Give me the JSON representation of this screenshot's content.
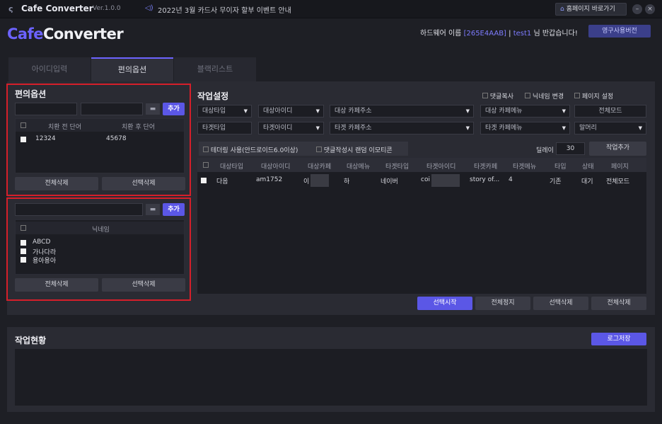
{
  "titlebar": {
    "title": "Cafe Converter",
    "version": "Ver.1.0.0",
    "notice": "2022년 3월 카드사 무이자 할부 이벤트 안내",
    "home_button": "홈페이지 바로가기",
    "minimize": "–",
    "close": "×"
  },
  "header": {
    "brand_part1": "Cafe",
    "brand_part2": "Converter",
    "hw_label": "하드웨어 이름 ",
    "hw_id": "[265E4AAB]",
    "separator": " | ",
    "user": "test1",
    "greeting": " 님 반갑습니다!",
    "license_button": "영구사용버전"
  },
  "tabs": [
    {
      "label": "아이디입력",
      "active": false
    },
    {
      "label": "편의옵션",
      "active": true
    },
    {
      "label": "블랙리스트",
      "active": false
    }
  ],
  "convenience": {
    "title": "편의옵션",
    "add_label": "추가",
    "folder_icon": "folder-icon",
    "replace_grid": {
      "col_before": "치환 전 단어",
      "col_after": "치환 후 단어",
      "rows": [
        {
          "before": "12324",
          "after": "45678"
        }
      ]
    },
    "delete_all": "전체삭제",
    "delete_selected": "선택삭제",
    "nick_grid": {
      "col": "닉네임",
      "rows": [
        "ABCD",
        "가나다라",
        "용아용아"
      ]
    }
  },
  "work_settings": {
    "title": "작업설정",
    "options": {
      "copy_comment": "댓글복사",
      "change_nick": "닉네임 변경",
      "page_setting": "페이지 설정"
    },
    "row1": {
      "target_type": "대상타입",
      "target_id": "대상아이디",
      "target_cafe_url": "대상 카페주소",
      "target_cafe_menu": "대상 카페메뉴",
      "full_mode": "전체모드"
    },
    "row2": {
      "type": "타겟타입",
      "id": "타겟아이디",
      "cafe_url": "타겟 카페주소",
      "cafe_menu": "타겟 카페메뉴",
      "head": "말머리"
    },
    "tethering": "테더링 사용(안드로이드6.0이상)",
    "random_emoticon": "댓글작성시 랜덤 이모티콘",
    "delay_label": "딜레이",
    "delay_value": "30",
    "add_task": "작업추가"
  },
  "task_grid": {
    "columns": [
      "대상타입",
      "대상아이디",
      "대상카페",
      "대상메뉴",
      "타겟타입",
      "타겟아이디",
      "타겟카페",
      "타겟메뉴",
      "타입",
      "상태",
      "페이지"
    ],
    "rows": [
      {
        "c0": "다음",
        "c1": "am1752",
        "c2": "이",
        "c3": "하",
        "c4": "네이버",
        "c5": "coi",
        "c6": "story of...",
        "c7": "4",
        "c8": "기존",
        "c9": "대기",
        "c10": "전체모드"
      }
    ]
  },
  "bottom_buttons": {
    "start_selected": "선택시작",
    "stop_all": "전체정지",
    "delete_selected": "선택삭제",
    "delete_all": "전체삭제"
  },
  "log": {
    "title": "작업현황",
    "save_button": "로그저장"
  },
  "colors": {
    "accent": "#5b57e6",
    "brand": "#6c63ff",
    "highlight_box": "#d51f2a"
  }
}
